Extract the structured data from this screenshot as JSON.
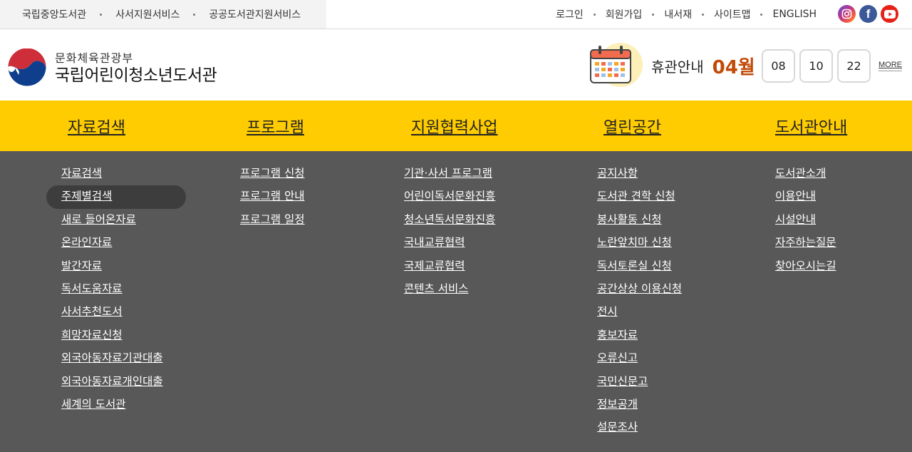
{
  "topbar": {
    "family_links": [
      "국립중앙도서관",
      "사서지원서비스",
      "공공도서관지원서비스"
    ],
    "util_links": [
      "로그인",
      "회원가입",
      "내서재",
      "사이트맵",
      "ENGLISH"
    ],
    "sns": [
      "instagram-icon",
      "facebook-icon",
      "youtube-icon"
    ]
  },
  "header": {
    "logo_sub": "문화체육관광부",
    "logo_main": "국립어린이청소년도서관",
    "closed_label": "휴관안내",
    "closed_month": "04월",
    "closed_days": [
      "08",
      "10",
      "22"
    ],
    "more_label": "MORE"
  },
  "gnb": [
    {
      "label": "자료검색",
      "subs": [
        "자료검색",
        "주제별검색",
        "새로 들어온자료",
        "온라인자료",
        "발간자료",
        "독서도움자료",
        "사서추천도서",
        "희망자료신청",
        "외국아동자료기관대출",
        "외국아동자료개인대출",
        "세계의 도서관"
      ],
      "active": 1
    },
    {
      "label": "프로그램",
      "subs": [
        "프로그램 신청",
        "프로그램 안내",
        "프로그램 일정"
      ]
    },
    {
      "label": "지원협력사업",
      "subs": [
        "기관·사서 프로그램",
        "어린이독서문화진흥",
        "청소년독서문화진흥",
        "국내교류협력",
        "국제교류협력",
        "콘텐츠 서비스"
      ]
    },
    {
      "label": "열린공간",
      "subs": [
        "공지사항",
        "도서관 견학 신청",
        "봉사활동 신청",
        "노란앞치마 신청",
        "독서토론실 신청",
        "공간상상 이용신청",
        "전시",
        "홍보자료",
        "오류신고",
        "국민신문고",
        "정보공개",
        "설문조사"
      ]
    },
    {
      "label": "도서관안내",
      "subs": [
        "도서관소개",
        "이용안내",
        "시설안내",
        "자주하는질문",
        "찾아오시는길"
      ]
    }
  ],
  "colors": {
    "accent": "#fecc00",
    "menu_bg": "#585858",
    "month": "#c24a06"
  }
}
